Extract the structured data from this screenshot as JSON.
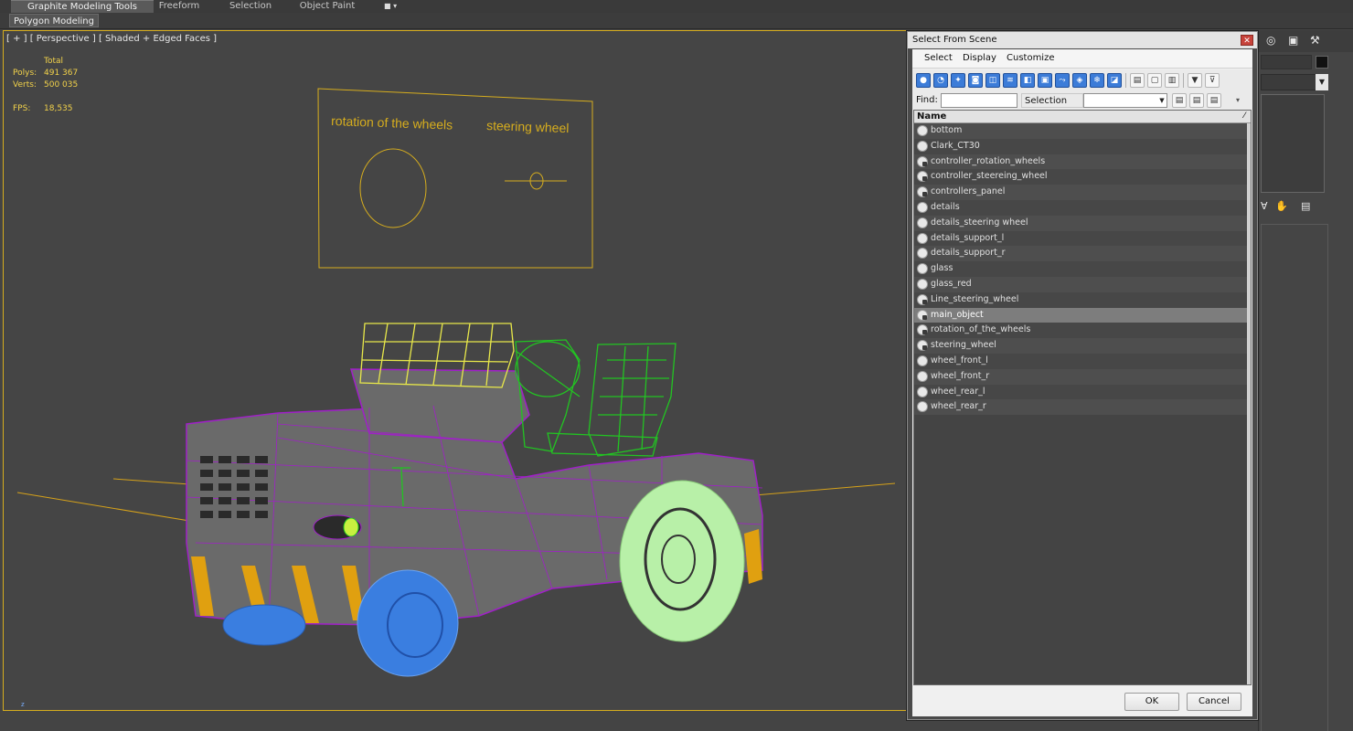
{
  "ribbon": {
    "tabs": [
      {
        "label": "Graphite Modeling Tools",
        "active": true
      },
      {
        "label": "Freeform",
        "active": false
      },
      {
        "label": "Selection",
        "active": false
      },
      {
        "label": "Object Paint",
        "active": false
      }
    ],
    "sub_label": "Polygon Modeling"
  },
  "viewport": {
    "label": "[ + ] [ Perspective ] [ Shaded + Edged Faces ]",
    "stats": {
      "total_label": "Total",
      "polys_label": "Polys:",
      "polys_value": "491 367",
      "verts_label": "Verts:",
      "verts_value": "500 035",
      "fps_label": "FPS:",
      "fps_value": "18,535"
    },
    "controller_panel": {
      "left_label": "rotation of the wheels",
      "right_label": "steering wheel"
    },
    "axis_label": "z"
  },
  "dialog": {
    "title": "Select From Scene",
    "close_icon": "close-icon",
    "menu": [
      "Select",
      "Display",
      "Customize"
    ],
    "find_label": "Find:",
    "find_value": "",
    "selection_set_label": "Selection Set:",
    "column_header": "Name",
    "items": [
      {
        "name": "bottom",
        "icon": "geometry-icon",
        "selected": false
      },
      {
        "name": "Clark_CT30",
        "icon": "geometry-icon",
        "selected": false
      },
      {
        "name": "controller_rotation_wheels",
        "icon": "shape-icon",
        "selected": false
      },
      {
        "name": "controller_steereing_wheel",
        "icon": "shape-icon",
        "selected": false
      },
      {
        "name": "controllers_panel",
        "icon": "shape-icon",
        "selected": false
      },
      {
        "name": "details",
        "icon": "geometry-icon",
        "selected": false
      },
      {
        "name": "details_steering wheel",
        "icon": "geometry-icon",
        "selected": false
      },
      {
        "name": "details_support_l",
        "icon": "geometry-icon",
        "selected": false
      },
      {
        "name": "details_support_r",
        "icon": "geometry-icon",
        "selected": false
      },
      {
        "name": "glass",
        "icon": "geometry-icon",
        "selected": false
      },
      {
        "name": "glass_red",
        "icon": "geometry-icon",
        "selected": false
      },
      {
        "name": "Line_steering_wheel",
        "icon": "shape-icon",
        "selected": false
      },
      {
        "name": "main_object",
        "icon": "shape-icon",
        "selected": true
      },
      {
        "name": "rotation_of_the_wheels",
        "icon": "shape-icon",
        "selected": false
      },
      {
        "name": "steering_wheel",
        "icon": "shape-icon",
        "selected": false
      },
      {
        "name": "wheel_front_l",
        "icon": "geometry-icon",
        "selected": false
      },
      {
        "name": "wheel_front_r",
        "icon": "geometry-icon",
        "selected": false
      },
      {
        "name": "wheel_rear_l",
        "icon": "geometry-icon",
        "selected": false
      },
      {
        "name": "wheel_rear_r",
        "icon": "geometry-icon",
        "selected": false
      }
    ],
    "ok_label": "OK",
    "cancel_label": "Cancel"
  },
  "colors": {
    "viewport_border": "#d6ad1e",
    "wire_purple": "#a020c8",
    "wire_green": "#22c422",
    "wire_yellow": "#e8e84a",
    "wheel_blue": "#3a7ee0",
    "wheel_lightgreen": "#b8f0a8",
    "stats_yellow": "#f2d24a"
  }
}
